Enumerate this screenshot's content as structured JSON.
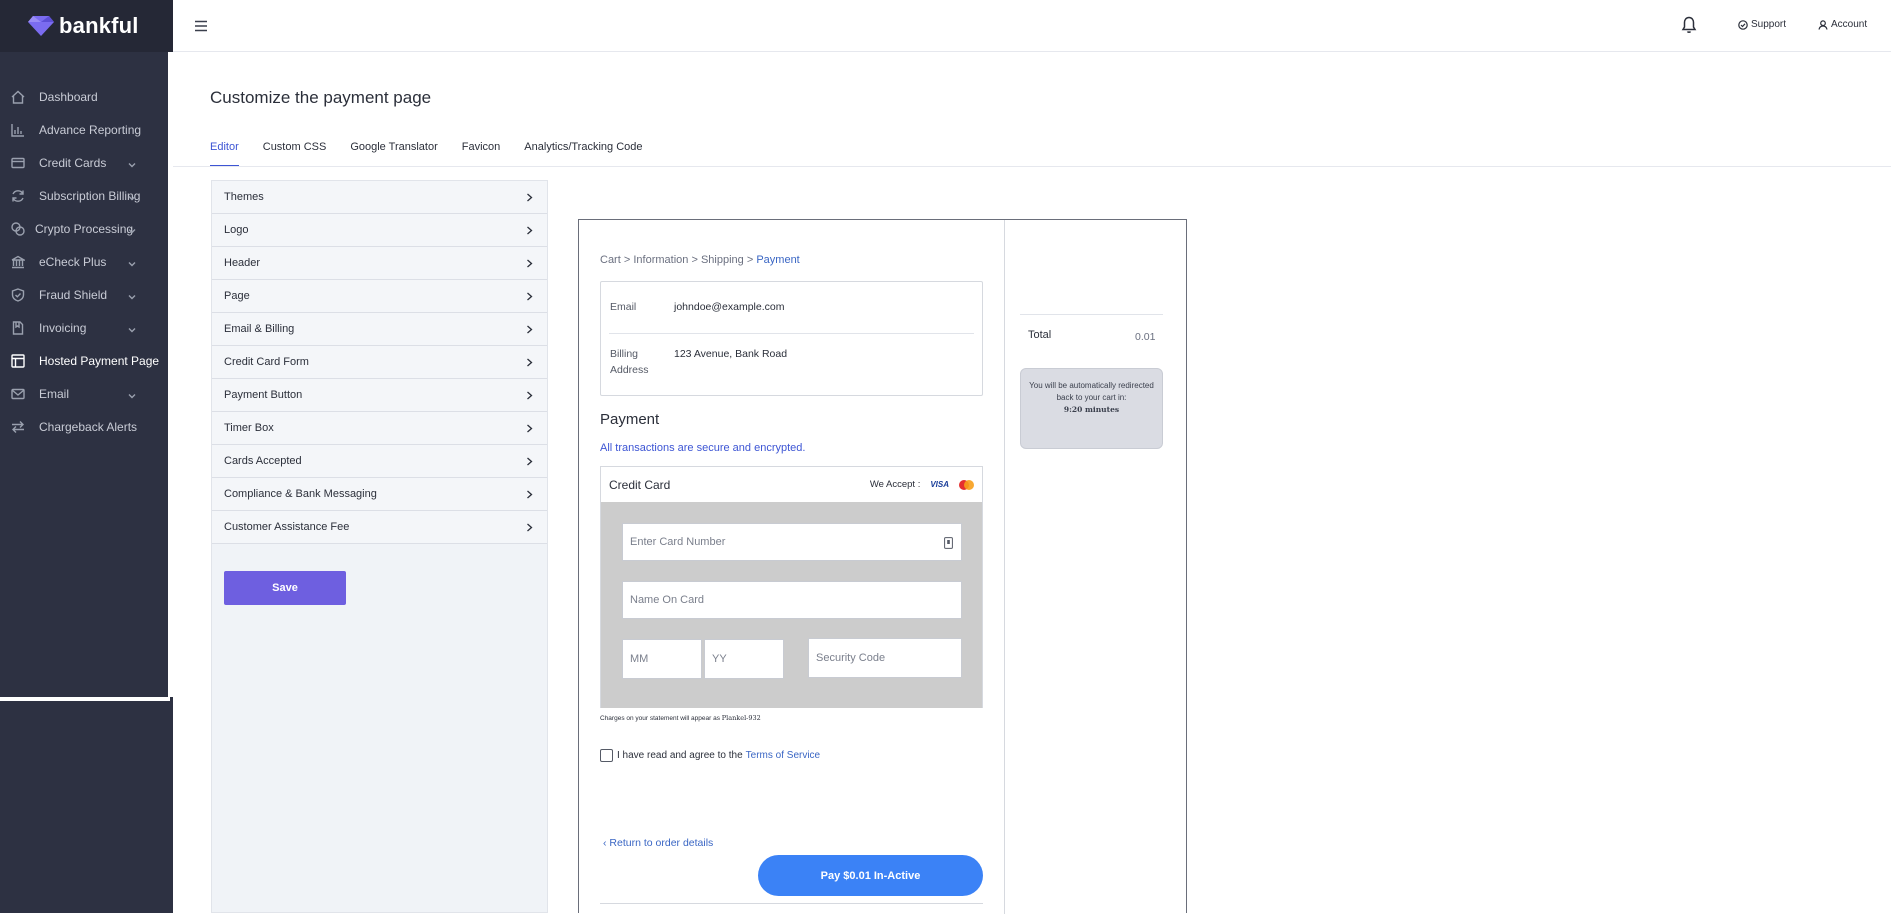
{
  "brand": {
    "name": "bankful"
  },
  "sidebar": {
    "items": [
      {
        "label": "Dashboard",
        "icon": "home-icon",
        "chevron": false
      },
      {
        "label": "Advance Reporting",
        "icon": "bar-chart-icon",
        "chevron": false
      },
      {
        "label": "Credit Cards",
        "icon": "credit-card-icon",
        "chevron": true
      },
      {
        "label": "Subscription Billing",
        "icon": "refresh-icon",
        "chevron": true
      },
      {
        "label": "Crypto Processing",
        "icon": "coins-icon",
        "chevron": true
      },
      {
        "label": "eCheck Plus",
        "icon": "bank-icon",
        "chevron": true
      },
      {
        "label": "Fraud Shield",
        "icon": "shield-icon",
        "chevron": true
      },
      {
        "label": "Invoicing",
        "icon": "document-icon",
        "chevron": true
      },
      {
        "label": "Hosted Payment Page",
        "icon": "layout-icon",
        "chevron": false,
        "active": true
      },
      {
        "label": "Email",
        "icon": "mail-icon",
        "chevron": true
      },
      {
        "label": "Chargeback Alerts",
        "icon": "arrows-icon",
        "chevron": false
      }
    ]
  },
  "topbar": {
    "support": "Support",
    "account": "Account"
  },
  "page": {
    "title": "Customize the payment page"
  },
  "tabs": [
    "Editor",
    "Custom CSS",
    "Google Translator",
    "Favicon",
    "Analytics/Tracking Code"
  ],
  "editor": {
    "sections": [
      "Themes",
      "Logo",
      "Header",
      "Page",
      "Email & Billing",
      "Credit Card Form",
      "Payment Button",
      "Timer Box",
      "Cards Accepted",
      "Compliance & Bank Messaging",
      "Customer Assistance Fee"
    ],
    "save_label": "Save"
  },
  "preview": {
    "crumbs": {
      "cart": "Cart",
      "information": "Information",
      "shipping": "Shipping",
      "payment": "Payment",
      "sep": ">"
    },
    "email_label": "Email",
    "email_value": "johndoe@example.com",
    "billing_label_1": "Billing",
    "billing_label_2": "Address",
    "billing_value": "123 Avenue, Bank Road",
    "payment_heading": "Payment",
    "secure_text": "All transactions are secure and encrypted.",
    "cc_title": "Credit Card",
    "we_accept": "We Accept :",
    "visa": "VISA",
    "card_number_placeholder": "Enter Card Number",
    "name_placeholder": "Name On Card",
    "mm_placeholder": "MM",
    "yy_placeholder": "YY",
    "cvv_placeholder": "Security Code",
    "statement_text": "Charges on your statement will appear as",
    "statement_descriptor": "Plankel-932",
    "tos_text": "I have read and agree to the",
    "tos_link": "Terms of Service",
    "return_link": "‹ Return to order details",
    "pay_button": "Pay $0.01 In-Active",
    "total_label": "Total",
    "total_value": "0.01",
    "timer_text": "You will be automatically redirected back to your cart in:",
    "timer_time": "9:20 minutes"
  },
  "colors": {
    "sidebar": "#2d3142",
    "accent": "#3d55d4",
    "save": "#6e5fe0",
    "pay": "#3b82f6"
  }
}
